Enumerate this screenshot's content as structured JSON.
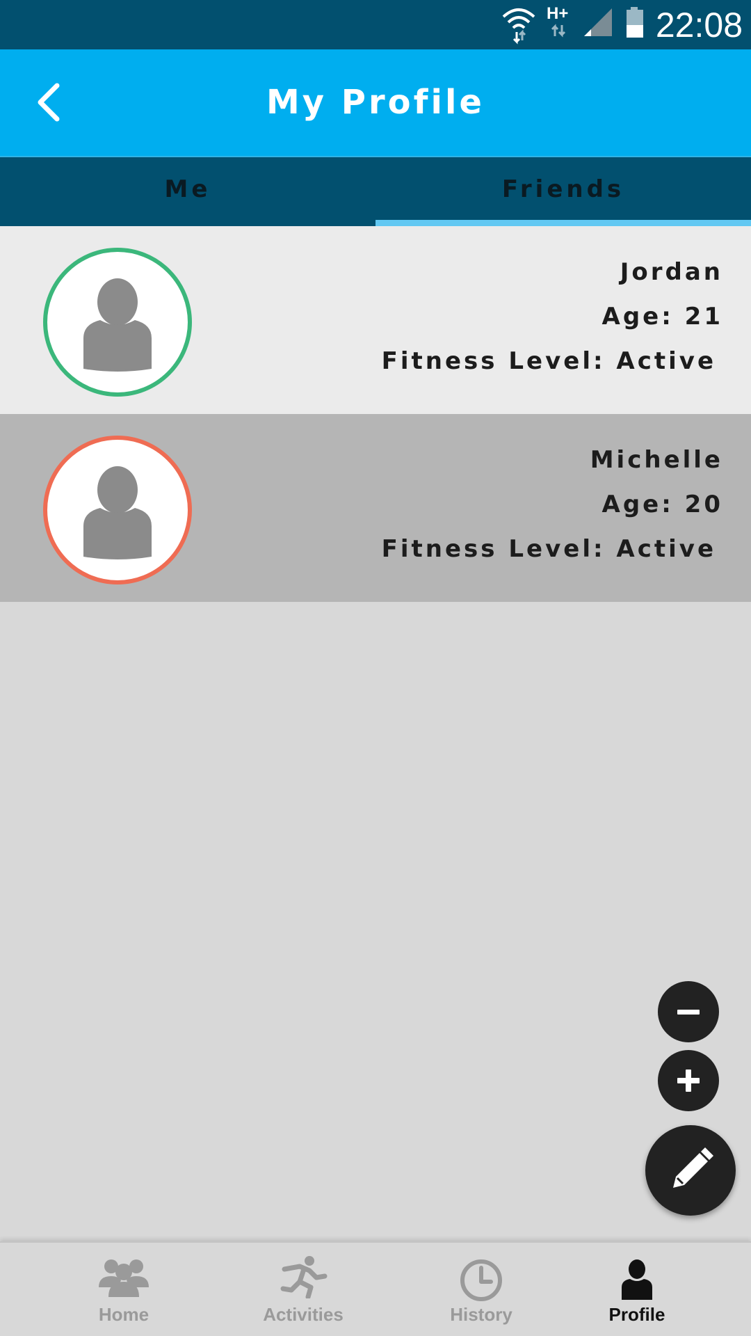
{
  "status_bar": {
    "time": "22:08",
    "network_type": "H+",
    "icons": [
      "wifi-icon",
      "mobile-data-icon",
      "signal-icon",
      "battery-icon"
    ]
  },
  "header": {
    "title": "My Profile",
    "back_icon": "chevron-left-icon"
  },
  "tabs": [
    {
      "label": "Me",
      "active": false
    },
    {
      "label": "Friends",
      "active": true
    }
  ],
  "friends": [
    {
      "name": "Jordan",
      "age": "Age: 21",
      "fitness": "Fitness Level: Active",
      "ring_color": "#3bb77b"
    },
    {
      "name": "Michelle",
      "age": "Age: 20",
      "fitness": "Fitness Level: Active",
      "ring_color": "#ef6c53"
    }
  ],
  "actions": {
    "remove_icon": "minus-icon",
    "add_icon": "plus-icon",
    "edit_icon": "pencil-icon"
  },
  "bottom_nav": [
    {
      "label": "Home",
      "icon": "group-icon",
      "active": false
    },
    {
      "label": "Activities",
      "icon": "running-person-icon",
      "active": false
    },
    {
      "label": "History",
      "icon": "clock-icon",
      "active": false
    },
    {
      "label": "Profile",
      "icon": "person-icon",
      "active": true
    }
  ],
  "colors": {
    "status_bar": "#02506f",
    "app_bar": "#00aeef",
    "tab_indicator": "#62c8f2",
    "background": "#d8d8d8"
  }
}
